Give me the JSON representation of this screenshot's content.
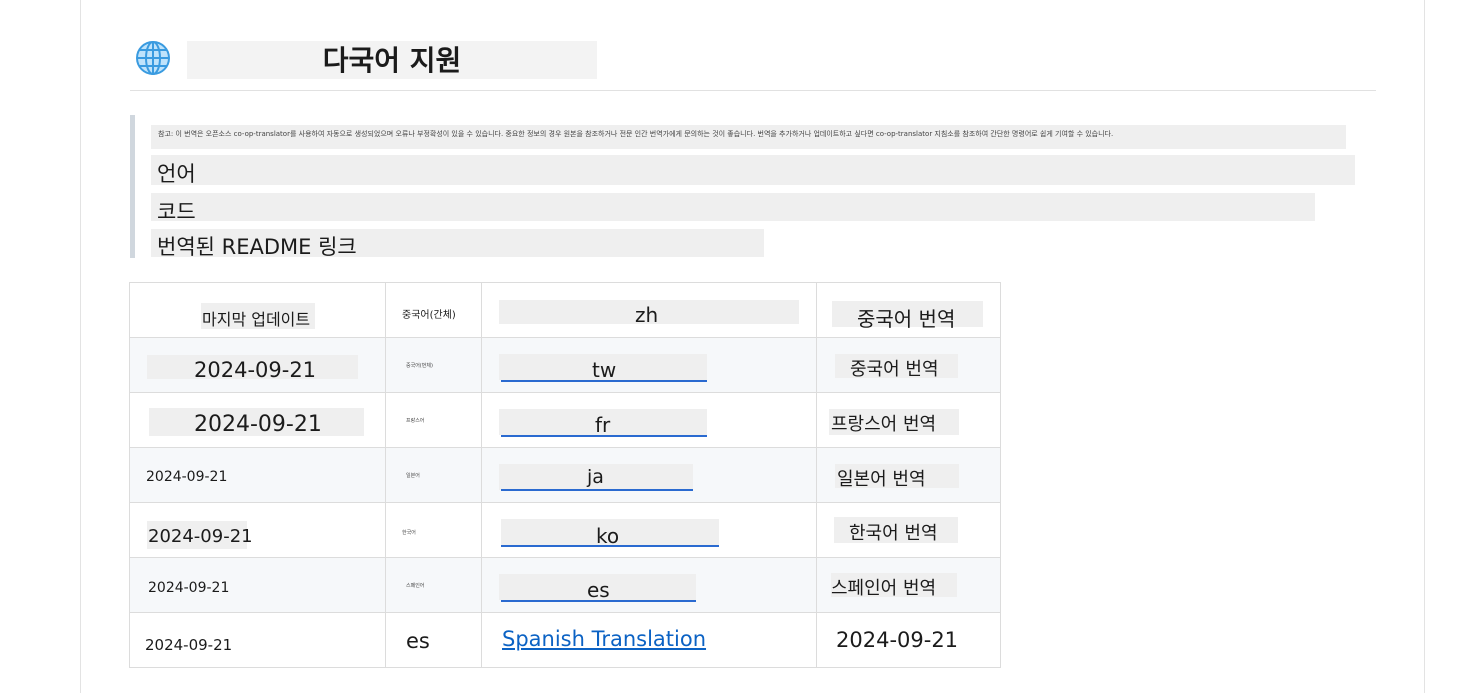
{
  "heading": {
    "icon": "globe-icon",
    "title": "다국어 지원"
  },
  "note": {
    "disclaimer": "참고: 이 번역은 오픈소스 co-op-translator를 사용하여 자동으로 생성되었으며 오류나 부정확성이 있을 수 있습니다. 중요한 정보의 경우 원본을 참조하거나 전문 인간 번역가에게 문의하는 것이 좋습니다. 번역을 추가하거나 업데이트하고 싶다면 co-op-translator 지침소를 참조하여 간단한 명령어로 쉽게 기여할 수 있습니다.",
    "items": [
      "언어",
      "코드",
      "번역된 README 링크"
    ]
  },
  "table": {
    "header": {
      "col1": "마지막 업데이트",
      "col2": "중국어(간체)",
      "col3": "zh",
      "col4": "중국어 번역"
    },
    "rows": [
      {
        "date": "2024-09-21",
        "lang": "중국어(번체)",
        "code": "tw",
        "link": "중국어 번역"
      },
      {
        "date": "2024-09-21",
        "lang": "프랑스어",
        "code": "fr",
        "link": "프랑스어 번역"
      },
      {
        "date": "2024-09-21",
        "lang": "일본어",
        "code": "ja",
        "link": "일본어 번역"
      },
      {
        "date": "2024-09-21",
        "lang": "한국어",
        "code": "ko",
        "link": "한국어 번역"
      },
      {
        "date": "2024-09-21",
        "lang": "스페인어",
        "code": "es",
        "link": "스페인어 번역"
      },
      {
        "date": "2024-09-21",
        "lang": "es",
        "code": "Spanish Translation",
        "link": "2024-09-21"
      }
    ]
  },
  "colors": {
    "link": "#0b62c4",
    "underline": "#2a6ad0",
    "stripe": "#f6f8fa",
    "placeholder": "#efefef"
  }
}
